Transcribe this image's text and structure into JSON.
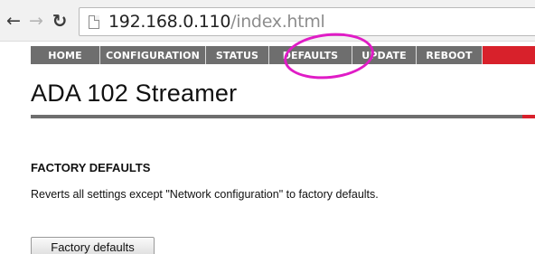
{
  "browser": {
    "url_host": "192.168.0.110",
    "url_path": "/index.html"
  },
  "nav": {
    "items": [
      {
        "label": "HOME"
      },
      {
        "label": "CONFIGURATION"
      },
      {
        "label": "STATUS"
      },
      {
        "label": "DEFAULTS"
      },
      {
        "label": "UPDATE"
      },
      {
        "label": "REBOOT"
      }
    ]
  },
  "page": {
    "title": "ADA 102 Streamer",
    "section_heading": "FACTORY DEFAULTS",
    "description": "Reverts all settings except \"Network configuration\" to factory defaults.",
    "button_label": "Factory defaults"
  },
  "colors": {
    "nav_background": "#6e6e6e",
    "accent": "#d8212b",
    "highlight": "#e01cc6"
  }
}
